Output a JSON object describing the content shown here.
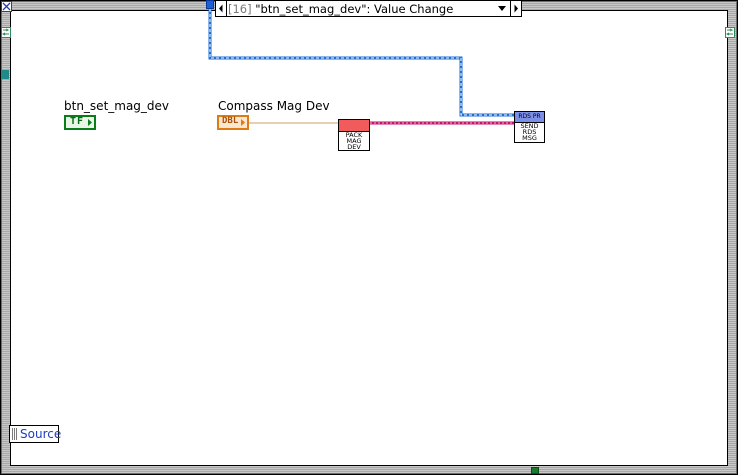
{
  "event_selector": {
    "index": "[16]",
    "label": "\"btn_set_mag_dev\": Value Change"
  },
  "controls": {
    "btn_set_mag_dev": {
      "label": "btn_set_mag_dev",
      "type_text": "TF"
    },
    "compass_mag_dev": {
      "label": "Compass Mag Dev",
      "type_text": "DBL"
    }
  },
  "subvis": {
    "pack": {
      "lines": [
        "PACK",
        "MAG",
        "DEV"
      ]
    },
    "send": {
      "header": "RDS PR",
      "lines": [
        "SEND",
        "RDS",
        "MSG"
      ]
    }
  },
  "source_terminal": {
    "label": "Source"
  },
  "colors": {
    "wire_dbl": "#c8a060",
    "wire_pink": "#c0166d",
    "wire_blue": "#1f6fd6",
    "pack_header": "#f25b5b",
    "send_header": "#7b8fe8",
    "bool_green": "#0a7d1a",
    "dbl_orange": "#e07a12"
  },
  "icons": [
    "x-close-icon",
    "event-data-node-icon",
    "dropdown-icon",
    "left-arrow-icon",
    "right-arrow-icon"
  ]
}
